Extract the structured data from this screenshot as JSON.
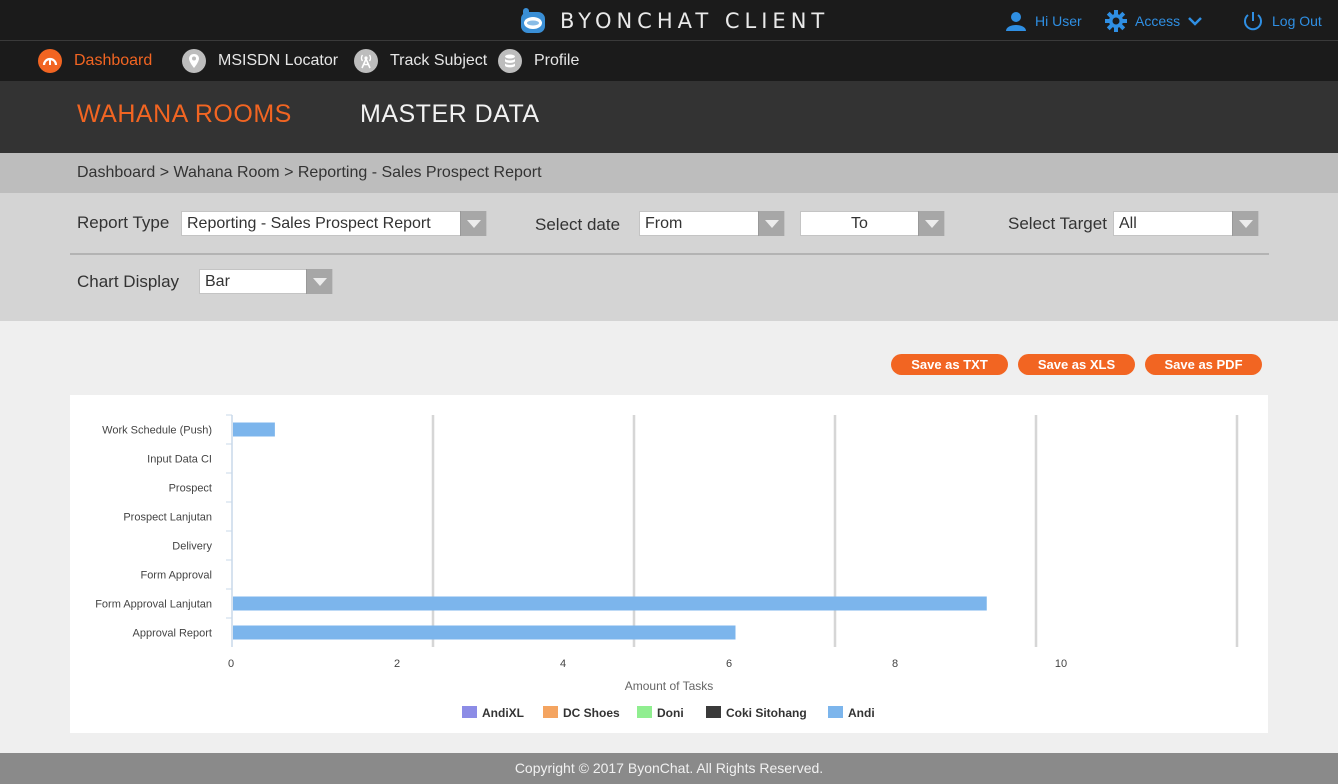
{
  "app": {
    "title": "BYONCHAT CLIENT"
  },
  "user": {
    "greeting": "Hi User",
    "access_label": "Access",
    "logout_label": "Log Out"
  },
  "nav": [
    {
      "label": "Dashboard",
      "icon": "dashboard-gauge-icon",
      "active": true
    },
    {
      "label": "MSISDN Locator",
      "icon": "location-pin-icon"
    },
    {
      "label": "Track Subject",
      "icon": "antenna-icon"
    },
    {
      "label": "Profile",
      "icon": "database-icon"
    }
  ],
  "sections": [
    {
      "label": "WAHANA ROOMS",
      "active": true
    },
    {
      "label": "MASTER DATA"
    }
  ],
  "breadcrumb": "Dashboard > Wahana Room > Reporting - Sales Prospect Report",
  "filters": {
    "report_type_label": "Report Type",
    "report_type_value": "Reporting - Sales Prospect  Report",
    "select_date_label": "Select date",
    "from_value": "From",
    "to_value": "To",
    "select_target_label": "Select Target",
    "target_value": "All",
    "chart_display_label": "Chart Display",
    "chart_display_value": "Bar"
  },
  "actions": {
    "save_txt": "Save as TXT",
    "save_xls": "Save as XLS",
    "save_pdf": "Save as PDF"
  },
  "chart_data": {
    "type": "bar",
    "orientation": "horizontal",
    "categories": [
      "Work Schedule (Push)",
      "Input Data CI",
      "Prospect",
      "Prospect Lanjutan",
      "Delivery",
      "Form Approval",
      "Form Approval Lanjutan",
      "Approval Report"
    ],
    "series": [
      {
        "name": "AndiXL",
        "color": "#8c8ce6",
        "values": [
          0,
          0,
          0,
          0,
          0,
          0,
          0,
          0
        ]
      },
      {
        "name": "DC Shoes",
        "color": "#f4a460",
        "values": [
          0,
          0,
          0,
          0,
          0,
          0,
          0,
          0
        ]
      },
      {
        "name": "Doni",
        "color": "#90ee90",
        "values": [
          0,
          0,
          0,
          0,
          0,
          0,
          0,
          0
        ]
      },
      {
        "name": "Coki Sitohang",
        "color": "#3a3a3a",
        "values": [
          0,
          0,
          0,
          0,
          0,
          0,
          0,
          0
        ]
      },
      {
        "name": "Andi",
        "color": "#7cb5ec",
        "values": [
          0.5,
          0,
          0,
          0,
          0,
          0,
          9,
          6
        ]
      }
    ],
    "xlabel": "Amount of Tasks",
    "xticks": [
      0,
      2,
      4,
      6,
      8,
      10
    ],
    "xlim": [
      0,
      10
    ],
    "grid": true,
    "legend_position": "bottom"
  },
  "footer": "Copyright © 2017 ByonChat. All Rights Reserved.",
  "colors": {
    "accent": "#f26522",
    "link": "#2f8fe3",
    "bar": "#7cb5ec"
  }
}
